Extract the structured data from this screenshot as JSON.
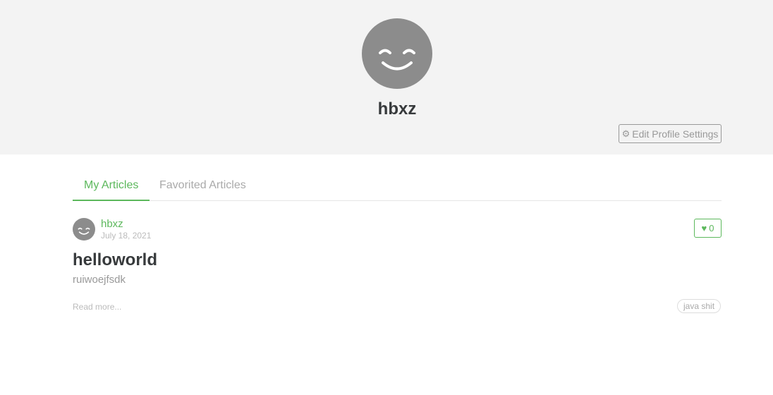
{
  "profile": {
    "username": "hbxz",
    "edit_button_label": "Edit Profile Settings",
    "edit_button_icon": "gear-icon"
  },
  "tabs": [
    {
      "label": "My Articles",
      "active": true
    },
    {
      "label": "Favorited Articles",
      "active": false
    }
  ],
  "articles": [
    {
      "author": "hbxz",
      "date": "July 18, 2021",
      "favorites_count": "0",
      "title": "helloworld",
      "description": "ruiwoejfsdk",
      "read_more": "Read more...",
      "tags": [
        "java shit"
      ]
    }
  ],
  "colors": {
    "accent": "#5cb85c",
    "banner_bg": "#f3f3f3",
    "avatar_bg": "#8c8c8c"
  }
}
